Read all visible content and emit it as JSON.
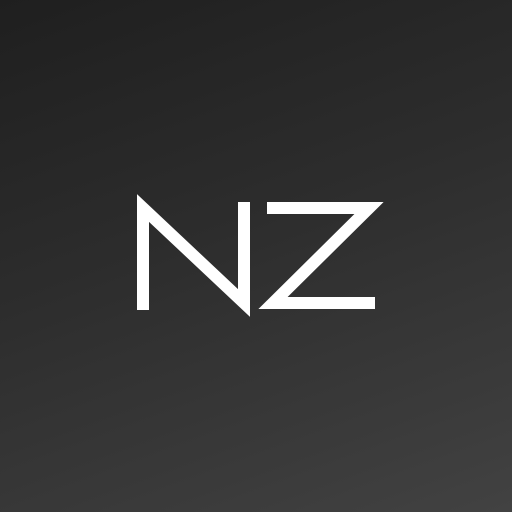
{
  "logo": {
    "text": "NZ",
    "color": "#ffffff"
  },
  "background": {
    "gradient_start": "#1f1f1f",
    "gradient_end": "#424242"
  }
}
